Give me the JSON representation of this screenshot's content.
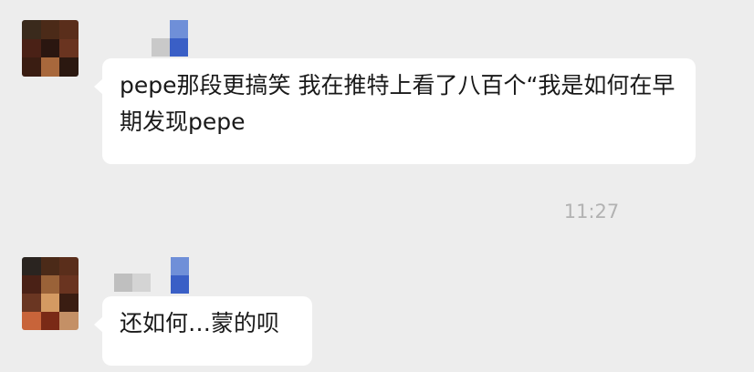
{
  "messages": [
    {
      "sender_name": "",
      "text": "pepe那段更搞笑 我在推特上看了八百个“我是如何在早期发现pepe"
    },
    {
      "sender_name": "",
      "text": "还如何…蒙的呗"
    }
  ],
  "timestamp": "11:27",
  "colors": {
    "background": "#ededed",
    "bubble": "#ffffff",
    "text": "#191919",
    "timestamp": "#b2b2b2"
  }
}
